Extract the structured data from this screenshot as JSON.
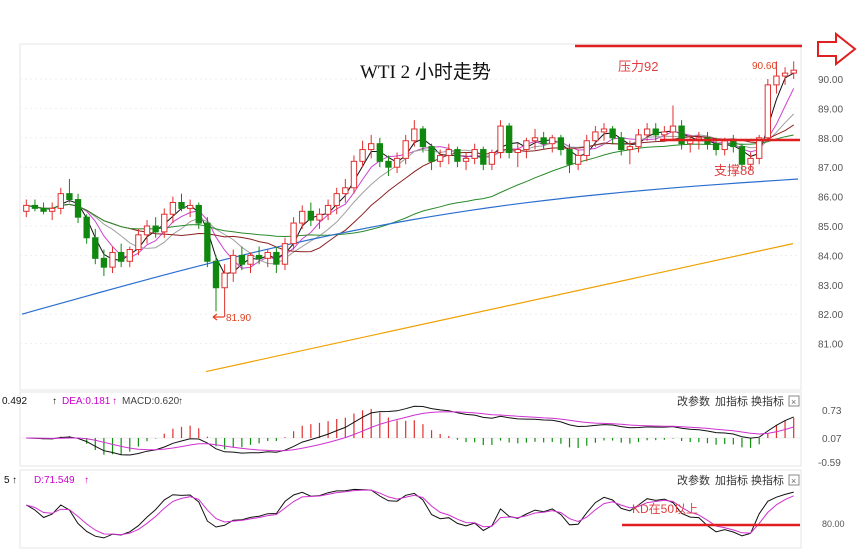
{
  "chart_data": {
    "type": "candlestick",
    "title": "WTI 2 小时走势",
    "price_axis": {
      "ticks": [
        "90.00",
        "89.00",
        "88.00",
        "87.00",
        "86.00",
        "85.00",
        "84.00",
        "83.00",
        "82.00",
        "81.00"
      ],
      "range": [
        80.0,
        90.8
      ]
    },
    "annotations": {
      "resistance": {
        "label": "压力92",
        "price": 91.1
      },
      "support": {
        "label": "支撑88",
        "price": 88.0
      },
      "low": {
        "label": "81.90",
        "price": 81.9
      },
      "high": {
        "label": "90.60",
        "price": 90.6
      }
    },
    "macd_panel": {
      "diff_label": "0.492",
      "dea_label": "DEA:0.181",
      "macd_label": "MACD:0.620",
      "ticks": [
        "0.73",
        "0.07",
        "-0.59"
      ],
      "buttons": [
        "改参数",
        "加指标",
        "换指标"
      ]
    },
    "kd_panel": {
      "k_label": "5",
      "d_label": "D:71.549",
      "buttons": [
        "改参数",
        "加指标",
        "换指标"
      ],
      "note": "KD在50以上",
      "tick": "80.00"
    },
    "candles": [
      [
        85.5,
        85.9,
        85.3,
        85.7
      ],
      [
        85.7,
        85.9,
        85.5,
        85.6
      ],
      [
        85.6,
        85.8,
        85.4,
        85.5
      ],
      [
        85.5,
        85.8,
        85.2,
        85.6
      ],
      [
        85.6,
        86.3,
        85.4,
        86.1
      ],
      [
        86.1,
        86.6,
        85.8,
        85.9
      ],
      [
        85.9,
        86.1,
        85.1,
        85.3
      ],
      [
        85.3,
        85.4,
        84.4,
        84.6
      ],
      [
        84.6,
        84.9,
        83.7,
        83.9
      ],
      [
        83.9,
        84.2,
        83.3,
        83.6
      ],
      [
        83.6,
        84.3,
        83.4,
        84.1
      ],
      [
        84.1,
        84.4,
        83.6,
        83.8
      ],
      [
        83.8,
        84.3,
        83.6,
        84.2
      ],
      [
        84.2,
        84.9,
        84.0,
        84.7
      ],
      [
        84.7,
        85.2,
        84.4,
        85.0
      ],
      [
        85.0,
        85.3,
        84.6,
        84.8
      ],
      [
        84.8,
        85.6,
        84.6,
        85.4
      ],
      [
        85.4,
        86.0,
        85.1,
        85.8
      ],
      [
        85.8,
        86.1,
        85.5,
        85.6
      ],
      [
        85.6,
        85.9,
        85.3,
        85.7
      ],
      [
        85.7,
        85.8,
        84.9,
        85.1
      ],
      [
        85.1,
        85.3,
        83.6,
        83.8
      ],
      [
        83.8,
        84.0,
        82.1,
        82.9
      ],
      [
        82.9,
        83.7,
        81.9,
        83.4
      ],
      [
        83.4,
        84.2,
        83.1,
        84.0
      ],
      [
        84.0,
        84.3,
        83.5,
        83.7
      ],
      [
        83.7,
        84.1,
        83.4,
        84.0
      ],
      [
        84.0,
        84.3,
        83.7,
        83.9
      ],
      [
        83.9,
        84.2,
        83.6,
        84.1
      ],
      [
        84.1,
        84.3,
        83.4,
        83.7
      ],
      [
        83.7,
        84.6,
        83.5,
        84.4
      ],
      [
        84.4,
        85.3,
        84.2,
        85.1
      ],
      [
        85.1,
        85.7,
        84.9,
        85.5
      ],
      [
        85.5,
        85.8,
        85.0,
        85.2
      ],
      [
        85.2,
        85.6,
        84.9,
        85.4
      ],
      [
        85.4,
        85.9,
        85.2,
        85.7
      ],
      [
        85.7,
        86.3,
        85.4,
        86.1
      ],
      [
        86.1,
        86.6,
        85.8,
        86.3
      ],
      [
        86.3,
        87.4,
        86.1,
        87.2
      ],
      [
        87.2,
        87.9,
        87.0,
        87.6
      ],
      [
        87.6,
        88.1,
        87.3,
        87.8
      ],
      [
        87.8,
        88.0,
        87.0,
        87.2
      ],
      [
        87.2,
        87.4,
        86.7,
        87.0
      ],
      [
        87.0,
        87.5,
        86.8,
        87.3
      ],
      [
        87.3,
        88.1,
        87.1,
        87.9
      ],
      [
        87.9,
        88.6,
        87.7,
        88.3
      ],
      [
        88.3,
        88.4,
        87.5,
        87.7
      ],
      [
        87.7,
        87.8,
        86.9,
        87.2
      ],
      [
        87.2,
        87.6,
        87.0,
        87.4
      ],
      [
        87.4,
        87.8,
        87.1,
        87.6
      ],
      [
        87.6,
        87.7,
        87.0,
        87.2
      ],
      [
        87.2,
        87.5,
        86.9,
        87.3
      ],
      [
        87.3,
        87.8,
        87.1,
        87.6
      ],
      [
        87.6,
        87.7,
        86.9,
        87.1
      ],
      [
        87.1,
        87.6,
        86.9,
        87.5
      ],
      [
        87.5,
        88.6,
        87.3,
        88.4
      ],
      [
        88.4,
        88.5,
        87.3,
        87.5
      ],
      [
        87.5,
        87.8,
        87.0,
        87.6
      ],
      [
        87.6,
        88.0,
        87.3,
        87.9
      ],
      [
        87.9,
        88.3,
        87.6,
        88.0
      ],
      [
        88.0,
        88.2,
        87.6,
        87.8
      ],
      [
        87.8,
        88.1,
        87.5,
        88.0
      ],
      [
        88.0,
        88.1,
        87.4,
        87.6
      ],
      [
        87.6,
        87.8,
        86.8,
        87.1
      ],
      [
        87.1,
        87.6,
        86.9,
        87.4
      ],
      [
        87.4,
        88.1,
        87.2,
        87.9
      ],
      [
        87.9,
        88.4,
        87.7,
        88.2
      ],
      [
        88.2,
        88.5,
        87.9,
        88.3
      ],
      [
        88.3,
        88.4,
        87.8,
        88.0
      ],
      [
        88.0,
        88.2,
        87.4,
        87.6
      ],
      [
        87.6,
        87.9,
        87.1,
        87.7
      ],
      [
        87.7,
        88.3,
        87.5,
        88.1
      ],
      [
        88.1,
        88.5,
        87.9,
        88.3
      ],
      [
        88.3,
        88.5,
        87.9,
        88.1
      ],
      [
        88.1,
        88.4,
        87.9,
        88.2
      ],
      [
        88.2,
        89.1,
        87.9,
        88.4
      ],
      [
        88.4,
        88.6,
        87.6,
        87.8
      ],
      [
        87.8,
        88.1,
        87.5,
        87.9
      ],
      [
        87.9,
        88.2,
        87.6,
        88.0
      ],
      [
        88.0,
        88.2,
        87.6,
        87.8
      ],
      [
        87.8,
        88.0,
        87.4,
        87.6
      ],
      [
        87.6,
        88.0,
        87.4,
        87.9
      ],
      [
        87.9,
        88.1,
        87.5,
        87.7
      ],
      [
        87.7,
        87.8,
        86.9,
        87.1
      ],
      [
        87.1,
        87.5,
        86.9,
        87.3
      ],
      [
        87.3,
        88.1,
        87.1,
        88.0
      ],
      [
        88.0,
        90.0,
        87.9,
        89.8
      ],
      [
        89.8,
        90.6,
        89.5,
        90.1
      ],
      [
        90.1,
        90.4,
        89.8,
        90.2
      ],
      [
        90.2,
        90.6,
        90.0,
        90.3
      ]
    ]
  }
}
